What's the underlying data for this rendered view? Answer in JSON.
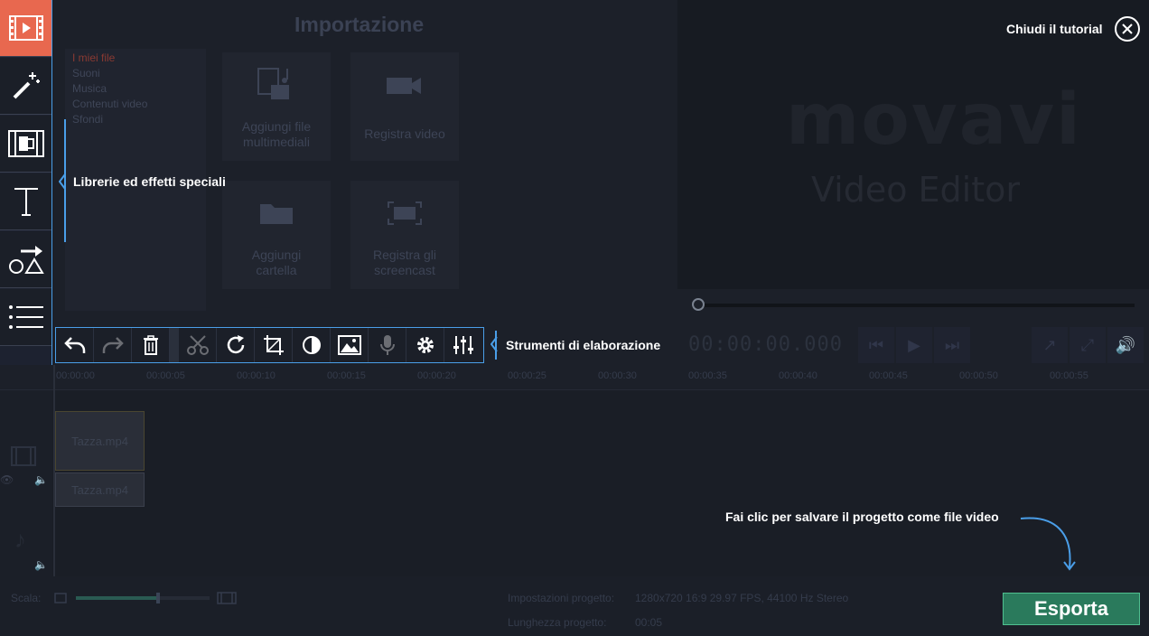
{
  "sidebar": {
    "items": [
      {
        "name": "import",
        "icon": "film-import-icon",
        "active": true
      },
      {
        "name": "filters",
        "icon": "magic-wand-icon"
      },
      {
        "name": "transitions",
        "icon": "film-transition-icon"
      },
      {
        "name": "titles",
        "icon": "text-title-icon"
      },
      {
        "name": "stickers",
        "icon": "shapes-arrow-icon"
      },
      {
        "name": "more",
        "icon": "list-menu-icon"
      }
    ]
  },
  "import": {
    "title": "Importazione",
    "library": [
      "I miei file",
      "Suoni",
      "Musica",
      "Contenuti video",
      "Sfondi"
    ],
    "tiles": [
      {
        "line1": "Aggiungi file",
        "line2": "multimediali"
      },
      {
        "line1": "Registra video",
        "line2": ""
      },
      {
        "line1": "Aggiungi",
        "line2": "cartella"
      },
      {
        "line1": "Registra gli",
        "line2": "screencast"
      }
    ]
  },
  "preview": {
    "logo": "movavi",
    "subtitle": "Video Editor",
    "timecode": "00:00:00.000"
  },
  "tutorial": {
    "close_label": "Chiudi il tutorial",
    "note_libraries": "Librerie ed effetti speciali",
    "note_tools": "Strumenti di elaborazione",
    "note_export": "Fai clic per salvare il progetto come file video"
  },
  "toolbar": {
    "tools": [
      "undo-icon",
      "redo-icon",
      "trash-icon",
      "scissors-icon",
      "rotate-icon",
      "crop-icon",
      "color-adjust-icon",
      "image-icon",
      "microphone-icon",
      "gear-icon",
      "equalizer-icon"
    ]
  },
  "ruler": {
    "labels": [
      "00:00:00",
      "00:00:05",
      "00:00:10",
      "00:00:15",
      "00:00:20",
      "00:00:25",
      "00:00:30",
      "00:00:35",
      "00:00:40",
      "00:00:45",
      "00:00:50",
      "00:00:55"
    ]
  },
  "timeline": {
    "video_clip": "Tazza.mp4",
    "audio_clip": "Tazza.mp4"
  },
  "bottom": {
    "scale_label": "Scala:",
    "settings_label": "Impostazioni progetto:",
    "settings_value": "1280x720 16:9 29.97 FPS, 44100 Hz Stereo",
    "length_label": "Lunghezza progetto:",
    "length_value": "00:05",
    "export_label": "Esporta"
  },
  "colors": {
    "accent": "#4a9ee8",
    "active_tab": "#e8684f",
    "export": "#2a7a5c"
  }
}
